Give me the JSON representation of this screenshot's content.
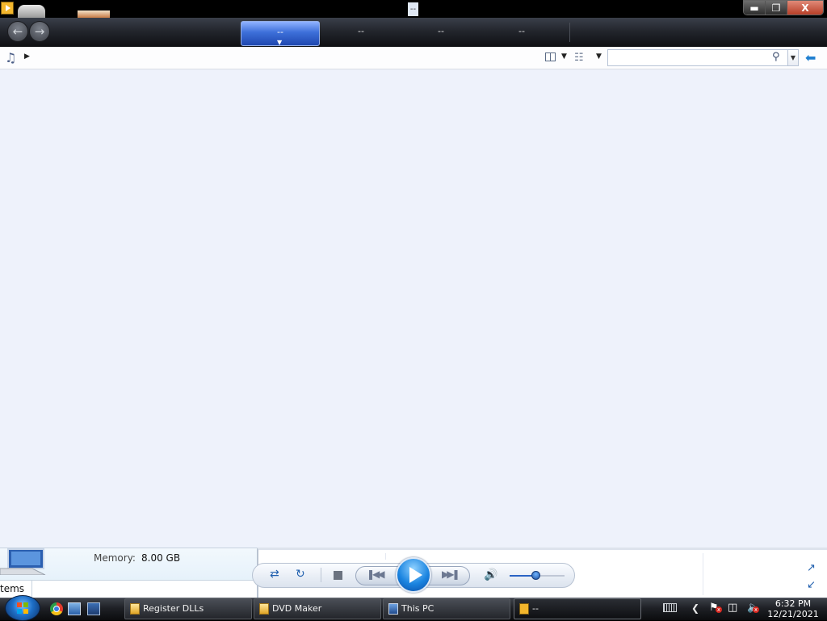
{
  "window": {
    "title": "--",
    "icon": "windows-media-player-icon",
    "controls": {
      "minimize": "▬",
      "maximize": "❐",
      "close": "X"
    }
  },
  "nav": {
    "back_icon": "back-arrow-icon",
    "forward_icon": "forward-arrow-icon",
    "tabs": [
      {
        "label": "--",
        "active": true
      },
      {
        "label": "--",
        "active": false
      },
      {
        "label": "--",
        "active": false
      },
      {
        "label": "--",
        "active": false
      }
    ]
  },
  "commandbar": {
    "library_icon": "music-icon",
    "search": {
      "value": "",
      "placeholder": ""
    },
    "search_icon": "search-icon",
    "switch_icon": "switch-to-now-playing-icon"
  },
  "details_panel": {
    "memory_label": "Memory:",
    "memory_value": "8.00 GB",
    "items_text": "tems"
  },
  "player": {
    "volume_level": 0.48,
    "icons": [
      "shuffle-icon",
      "repeat-icon",
      "stop-icon",
      "previous-icon",
      "play-icon",
      "next-icon",
      "volume-icon"
    ]
  },
  "taskbar": {
    "tasks": [
      {
        "label": "Register DLLs",
        "icon": "folder-icon"
      },
      {
        "label": "DVD Maker",
        "icon": "folder-icon"
      },
      {
        "label": "This PC",
        "icon": "computer-icon"
      },
      {
        "label": "--",
        "icon": "windows-media-player-icon"
      }
    ],
    "clock": {
      "time": "6:32 PM",
      "date": "12/21/2021"
    }
  },
  "colors": {
    "content_background": "#eef2fb",
    "accent_tab": "#3d6fd9",
    "taskbar": "#1e2025"
  }
}
